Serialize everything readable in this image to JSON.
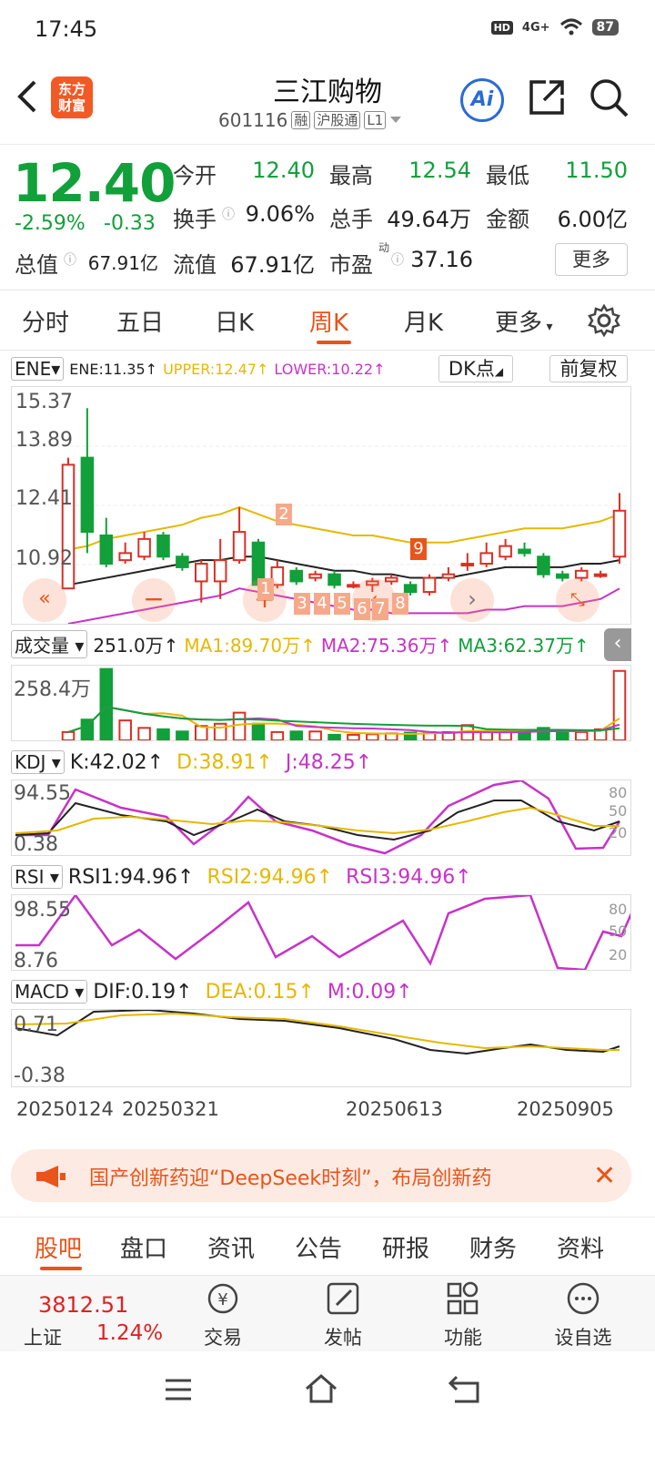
{
  "status": {
    "time": "17:45",
    "hd": "HD",
    "network": "4G+",
    "battery": "87"
  },
  "header": {
    "title": "三江购物",
    "logo_line1": "东方",
    "logo_line2": "财富",
    "code": "601116",
    "tags": [
      "融",
      "沪股通",
      "L1"
    ],
    "ai_label": "Ai"
  },
  "quote": {
    "price": "12.40",
    "change_pct": "-2.59%",
    "change": "-0.33",
    "row1": [
      {
        "label": "今开",
        "value": "12.40"
      },
      {
        "label": "最高",
        "value": "12.54"
      },
      {
        "label": "最低",
        "value": "11.50"
      }
    ],
    "row2": [
      {
        "label": "换手",
        "value": "9.06%"
      },
      {
        "label": "总手",
        "value": "49.64万"
      },
      {
        "label": "金额",
        "value": "6.00亿"
      }
    ],
    "row3": [
      {
        "label": "总值",
        "value": "67.91亿"
      },
      {
        "label": "流值",
        "value": "67.91亿"
      },
      {
        "label": "市盈",
        "value": "37.16",
        "sup": "动"
      }
    ],
    "more": "更多"
  },
  "tabs": [
    "分时",
    "五日",
    "日K",
    "周K",
    "月K",
    "更多"
  ],
  "active_tab": "周K",
  "ene": {
    "selector": "ENE",
    "ene": "ENE:11.35↑",
    "upper": "UPPER:12.47↑",
    "lower": "LOWER:10.22↑",
    "dk": "DK点",
    "fq": "前复权"
  },
  "price_axis": [
    "15.37",
    "13.89",
    "12.41",
    "10.92"
  ],
  "vol": {
    "selector": "成交量",
    "value": "251.0万↑",
    "ma1": "MA1:89.70万↑",
    "ma2": "MA2:75.36万↑",
    "ma3": "MA3:62.37万↑",
    "axis": "258.4万"
  },
  "kdj": {
    "selector": "KDJ",
    "k": "K:42.02↑",
    "d": "D:38.91↑",
    "j": "J:48.25↑",
    "axis_hi": "94.55",
    "axis_lo": "0.38",
    "ticks": [
      "80",
      "50",
      "20"
    ]
  },
  "rsi": {
    "selector": "RSI",
    "rsi1": "RSI1:94.96↑",
    "rsi2": "RSI2:94.96↑",
    "rsi3": "RSI3:94.96↑",
    "axis_hi": "98.55",
    "axis_lo": "8.76",
    "ticks": [
      "80",
      "50",
      "20"
    ]
  },
  "macd": {
    "selector": "MACD",
    "dif": "DIF:0.19↑",
    "dea": "DEA:0.15↑",
    "m": "M:0.09↑",
    "axis_hi": "0.71",
    "axis_lo": "-0.38"
  },
  "dates": [
    "20250124",
    "20250321",
    "20250613",
    "20250905"
  ],
  "markers": [
    "1",
    "2",
    "3",
    "4",
    "5",
    "6",
    "7",
    "8",
    "9"
  ],
  "banner": {
    "text": "国产创新药迎“DeepSeek时刻”，布局创新药"
  },
  "bottom_tabs": [
    "股吧",
    "盘口",
    "资讯",
    "公告",
    "研报",
    "财务",
    "资料"
  ],
  "footer": {
    "index_value": "3812.51",
    "index_name": "上证",
    "index_pct": "1.24%",
    "buttons": [
      "交易",
      "发帖",
      "功能",
      "设自选"
    ]
  },
  "colors": {
    "up": "#d93025",
    "down": "#11a03a",
    "accent": "#e8541a",
    "ma_yellow": "#e6b800",
    "ma_purple": "#c832c8"
  },
  "chart_data": {
    "type": "candlestick",
    "candles": [
      {
        "o": 10.2,
        "c": 13.7,
        "h": 13.9,
        "l": 10.2
      },
      {
        "o": 13.9,
        "c": 11.8,
        "h": 15.3,
        "l": 11.2
      },
      {
        "o": 11.7,
        "c": 10.9,
        "h": 12.2,
        "l": 10.8
      },
      {
        "o": 11.0,
        "c": 11.2,
        "h": 11.5,
        "l": 10.9
      },
      {
        "o": 11.1,
        "c": 11.6,
        "h": 11.8,
        "l": 11.0
      },
      {
        "o": 11.7,
        "c": 11.1,
        "h": 11.8,
        "l": 11.0
      },
      {
        "o": 11.1,
        "c": 10.8,
        "h": 11.2,
        "l": 10.7
      },
      {
        "o": 10.4,
        "c": 10.9,
        "h": 11.0,
        "l": 9.8
      },
      {
        "o": 10.4,
        "c": 11.0,
        "h": 11.6,
        "l": 9.9
      },
      {
        "o": 11.0,
        "c": 11.8,
        "h": 12.5,
        "l": 10.9
      },
      {
        "o": 11.5,
        "c": 10.3,
        "h": 11.6,
        "l": 10.2
      },
      {
        "o": 10.3,
        "c": 10.8,
        "h": 11.0,
        "l": 10.2
      },
      {
        "o": 10.7,
        "c": 10.4,
        "h": 10.8,
        "l": 10.3
      },
      {
        "o": 10.5,
        "c": 10.6,
        "h": 10.7,
        "l": 10.4
      },
      {
        "o": 10.6,
        "c": 10.3,
        "h": 10.7,
        "l": 10.2
      },
      {
        "o": 10.3,
        "c": 10.3,
        "h": 10.4,
        "l": 10.2
      },
      {
        "o": 10.3,
        "c": 10.4,
        "h": 10.5,
        "l": 10.1
      },
      {
        "o": 10.4,
        "c": 10.5,
        "h": 10.6,
        "l": 10.3
      },
      {
        "o": 10.3,
        "c": 10.1,
        "h": 10.4,
        "l": 10.0
      },
      {
        "o": 10.1,
        "c": 10.5,
        "h": 10.6,
        "l": 10.0
      },
      {
        "o": 10.5,
        "c": 10.6,
        "h": 10.8,
        "l": 10.4
      },
      {
        "o": 10.9,
        "c": 10.9,
        "h": 11.2,
        "l": 10.7
      },
      {
        "o": 10.9,
        "c": 11.2,
        "h": 11.5,
        "l": 10.8
      },
      {
        "o": 11.1,
        "c": 11.4,
        "h": 11.6,
        "l": 11.0
      },
      {
        "o": 11.3,
        "c": 11.2,
        "h": 11.5,
        "l": 11.1
      },
      {
        "o": 11.1,
        "c": 10.6,
        "h": 11.2,
        "l": 10.5
      },
      {
        "o": 10.6,
        "c": 10.5,
        "h": 10.7,
        "l": 10.4
      },
      {
        "o": 10.5,
        "c": 10.7,
        "h": 10.8,
        "l": 10.4
      },
      {
        "o": 10.6,
        "c": 10.6,
        "h": 10.7,
        "l": 10.5
      },
      {
        "o": 11.1,
        "c": 12.4,
        "h": 12.9,
        "l": 10.9
      }
    ],
    "ene": [
      10.3,
      10.4,
      10.5,
      10.6,
      10.7,
      10.8,
      10.9,
      11.0,
      11.0,
      11.1,
      11.1,
      11.0,
      10.9,
      10.8,
      10.7,
      10.7,
      10.6,
      10.6,
      10.5,
      10.5,
      10.5,
      10.6,
      10.7,
      10.8,
      10.8,
      10.8,
      10.8,
      10.9,
      10.9,
      11.0
    ],
    "upper": [
      11.3,
      11.4,
      11.6,
      11.7,
      11.8,
      11.9,
      12.0,
      12.2,
      12.3,
      12.5,
      12.3,
      12.1,
      12.0,
      11.9,
      11.8,
      11.7,
      11.7,
      11.6,
      11.5,
      11.5,
      11.5,
      11.6,
      11.7,
      11.8,
      11.9,
      11.9,
      11.9,
      12.0,
      12.1,
      12.3
    ],
    "lower": [
      9.2,
      9.3,
      9.4,
      9.5,
      9.6,
      9.7,
      9.8,
      9.9,
      10.0,
      10.2,
      10.1,
      10.0,
      9.9,
      9.8,
      9.7,
      9.6,
      9.6,
      9.5,
      9.5,
      9.5,
      9.5,
      9.5,
      9.6,
      9.6,
      9.7,
      9.7,
      9.7,
      9.8,
      9.9,
      10.2
    ],
    "ylim": [
      9.2,
      15.9
    ],
    "volume": [
      30,
      75,
      258,
      72,
      45,
      40,
      32,
      52,
      60,
      100,
      60,
      30,
      32,
      32,
      20,
      20,
      22,
      25,
      28,
      30,
      30,
      55,
      30,
      30,
      30,
      45,
      30,
      30,
      40,
      251
    ],
    "vol_ylim": [
      0,
      270
    ]
  }
}
